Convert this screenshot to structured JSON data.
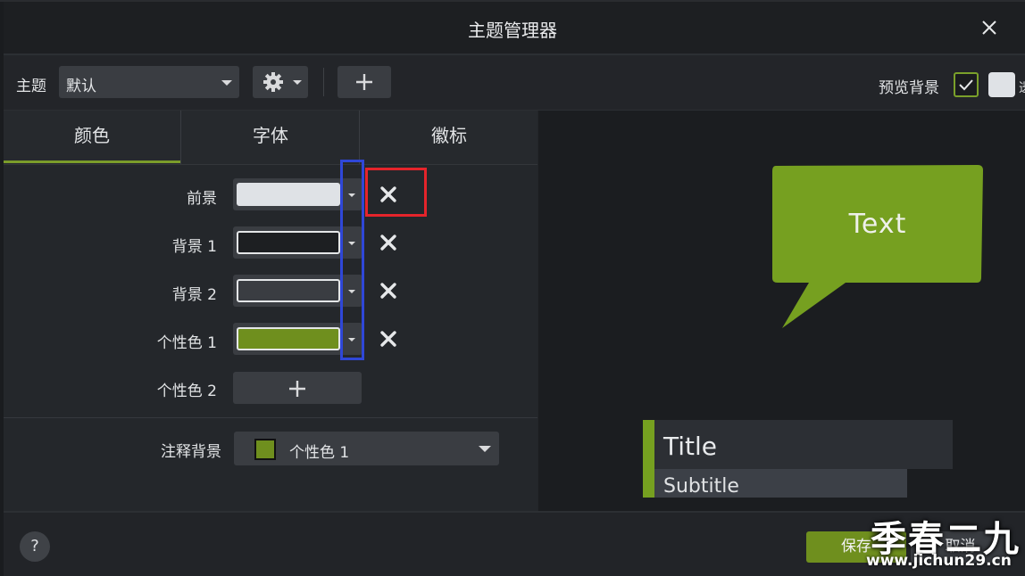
{
  "window": {
    "title": "主题管理器"
  },
  "toolbar": {
    "theme_label": "主题",
    "theme_value": "默认",
    "preview_background_label": "预览背景",
    "preview_background_clip": "透"
  },
  "tabs": [
    {
      "label": "颜色",
      "active": true
    },
    {
      "label": "字体",
      "active": false
    },
    {
      "label": "徽标",
      "active": false
    }
  ],
  "colors": {
    "rows": [
      {
        "label": "前景",
        "color": "#dfe2e6",
        "border": "#dfe2e6"
      },
      {
        "label": "背景 1",
        "color": "#1d1f22",
        "border": "#e4e6e8"
      },
      {
        "label": "背景 2",
        "color": "#3a3d42",
        "border": "#e4e6e8"
      },
      {
        "label": "个性色 1",
        "color": "#6f8f1e",
        "border": "#e4e6e8"
      }
    ],
    "add_label": "个性色 2",
    "annotation_label": "注释背景",
    "annotation_value": "个性色 1",
    "annotation_color": "#6f8f1e"
  },
  "preview": {
    "callout_text": "Text",
    "callout_color": "#76a020",
    "title_text": "Title",
    "subtitle_text": "Subtitle"
  },
  "footer": {
    "help": "?",
    "save": "保存",
    "cancel": "取消"
  },
  "watermark": {
    "brand": "季春二九",
    "url": "www.jichun29.cn"
  }
}
